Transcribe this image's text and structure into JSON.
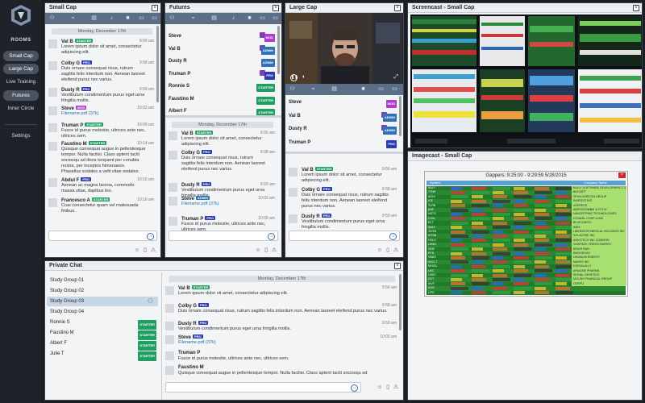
{
  "nav": {
    "rooms_label": "ROOMS",
    "items": [
      {
        "label": "Small Cap",
        "active": true
      },
      {
        "label": "Large Cap",
        "active": true
      },
      {
        "label": "Live Training",
        "active": false
      },
      {
        "label": "Futures",
        "active": true
      },
      {
        "label": "Inner Circle",
        "active": false
      }
    ],
    "settings_label": "Settings"
  },
  "small_cap": {
    "title": "Small Cap",
    "day": "Monday, December 17th",
    "messages": [
      {
        "name": "Val B",
        "badge": "STARTER",
        "badge_type": "starter",
        "time": "9:56 am",
        "text": "Lorem ipsum dolor sit amet, consectetur adipiscing elit."
      },
      {
        "name": "Colby G",
        "badge": "PRO",
        "badge_type": "pro",
        "time": "9:58 am",
        "text": "Duis ornare consequat risus, rutrum sagittis felis interdum non. Aenean laoreet eleifend purus nec varius."
      },
      {
        "name": "Dusty R",
        "badge": "PRO",
        "badge_type": "pro",
        "time": "9:59 am",
        "text": "Vestibulum condimentum purus eget urna fringilla mollis."
      },
      {
        "name": "Steve",
        "badge": "MOD",
        "badge_type": "mod",
        "time": "10:03 am",
        "text": "",
        "file": "Filename.pdf (37k)"
      },
      {
        "name": "Truman P",
        "badge": "STARTER",
        "badge_type": "starter",
        "time": "10:09 am",
        "text": "Fusce id purus molestie, ultrices ante nec, ultrices sem."
      },
      {
        "name": "Faustino M",
        "badge": "STARTER",
        "badge_type": "starter",
        "time": "10:14 am",
        "text": "Quisque consequat augue in pellentesque tempor. Nulla facilisi. Class aptent taciti sociosqu ad litora torquent per conubia nostra, per inceptos himenaeos. Phasellus sodales a velit vitae sodales."
      },
      {
        "name": "Abdul F",
        "badge": "PRO",
        "badge_type": "pro",
        "time": "10:15 am",
        "text": "Aenean ac magna lacinia, commodo massa vitae, dapibus leo."
      },
      {
        "name": "Francesco A",
        "badge": "STARTER",
        "badge_type": "starter",
        "time": "10:16 am",
        "text": "Cras consectetur quam vel malesuada finibus."
      }
    ]
  },
  "futures": {
    "title": "Futures",
    "users": [
      {
        "name": "Steve",
        "badge": "MOD",
        "badge_type": "mod",
        "icon": true
      },
      {
        "name": "Val B",
        "badge": "ADMIN",
        "badge_type": "admin",
        "icon": true
      },
      {
        "name": "Dusty R",
        "badge": "ADMIN",
        "badge_type": "admin",
        "icon": false
      },
      {
        "name": "Truman P",
        "badge": "PRO",
        "badge_type": "pro",
        "icon": true
      },
      {
        "name": "Ronnie S",
        "badge": "STARTER",
        "badge_type": "starter",
        "icon": false
      },
      {
        "name": "Faustino M",
        "badge": "STARTER",
        "badge_type": "starter",
        "icon": false
      },
      {
        "name": "Albert F",
        "badge": "STARTER",
        "badge_type": "starter",
        "icon": false
      }
    ],
    "day": "Monday, December 17th",
    "messages": [
      {
        "name": "Val B",
        "badge": "STARTER",
        "badge_type": "starter",
        "time": "9:56 am",
        "text": "Lorem ipsum dolor sit amet, consectetur adipiscing elit."
      },
      {
        "name": "Colby G",
        "badge": "PRO",
        "badge_type": "pro",
        "time": "9:58 am",
        "text": "Duis ornare consequat risus, rutrum sagittis felis interdum non. Aenean laoreet eleifend purus nec varius."
      },
      {
        "name": "Dusty R",
        "badge": "PRO",
        "badge_type": "pro",
        "time": "9:59 am",
        "text": "Vestibulum condimentum purus eget urna fringilla mollis."
      },
      {
        "name": "Steve",
        "badge": "ADMIN",
        "badge_type": "admin",
        "time": "10:03 am",
        "text": "",
        "file": "Filename.pdf (37k)"
      },
      {
        "name": "Truman P",
        "badge": "PRO",
        "badge_type": "pro",
        "time": "10:09 am",
        "text": "Fusce id purus molestie, ultrices ante nec, ultrices sem."
      }
    ]
  },
  "large_cap": {
    "title": "Large Cap",
    "users": [
      {
        "name": "Steve",
        "badge": "MOD",
        "badge_type": "mod",
        "icon": false
      },
      {
        "name": "Val B",
        "badge": "ADMIN",
        "badge_type": "admin",
        "icon": true
      },
      {
        "name": "Dusty R",
        "badge": "ADMIN",
        "badge_type": "admin",
        "icon": true
      },
      {
        "name": "Truman P",
        "badge": "PRO",
        "badge_type": "pro",
        "icon": false
      }
    ],
    "messages": [
      {
        "name": "Val B",
        "badge": "STARTER",
        "badge_type": "starter",
        "time": "9:56 am",
        "text": "Lorem ipsum dolor sit amet, consectetur adipiscing elit."
      },
      {
        "name": "Colby G",
        "badge": "PRO",
        "badge_type": "pro",
        "time": "9:58 am",
        "text": "Duis ornare consequat risus, rutrum sagittis felis interdum non. Aenean laoreet eleifend purus nec varius."
      },
      {
        "name": "Dusty R",
        "badge": "PRO",
        "badge_type": "pro",
        "time": "9:59 am",
        "text": "Vestibulum condimentum purus eget urna fringilla mollis."
      }
    ]
  },
  "screencast": {
    "title": "Screencast - Small Cap"
  },
  "imagecast": {
    "title": "Imagecast - Small Cap",
    "window_title": "Gappers:  9:25:00 - 9:29:59     5/28/2015",
    "columns": [
      "Symbol",
      "Company Name"
    ],
    "symbols": [
      "BALY",
      "TTNP",
      "ADHI",
      "ICE",
      "TLRB",
      "ANF",
      "NSTG",
      "CVIA",
      "ELT",
      "IMAX",
      "JCOM",
      "WTAB",
      "HOLX",
      "LEMU",
      "SBSI",
      "PFN",
      "VBAS",
      "ASCLT",
      "MHGA",
      "UEC",
      "LNDC",
      "DCT",
      "IKVF",
      "KGD",
      "CPS"
    ],
    "companies": [
      "BALLY SOFTWARE DEVELOPMENT CORP",
      "BIOCEPT",
      "SFHA HORIZON GROUP",
      "INVESCO BIO",
      "ASPRESS",
      "ABERCROMBIE & FITCH",
      "NANOSTRING TECHNOLOGIES",
      "DYNASIL CORP of AM",
      "BLUE EARTH",
      "IMAX",
      "LIBERATOR MEDICAL HOLDINGS INC",
      "SOLAZYME INC",
      "ADEXTECH INC COMMON",
      "VIASPACE GREEN ENERGY",
      "BRIGHTBAY",
      "BMGHEGAS",
      "URANIUM ENERGY",
      "MARKS INC",
      "DIGITALALLY",
      "ARIADNE PHARMA",
      "SIGNAL GENETICS",
      "MOLINO FINANCIAL GROUP",
      "DORPO"
    ]
  },
  "private_chat": {
    "title": "Private Chat",
    "groups": [
      {
        "label": "Study Group 01",
        "badge": "",
        "active": false
      },
      {
        "label": "Study Group 02",
        "badge": "",
        "active": false
      },
      {
        "label": "Study Group 03",
        "badge": "",
        "active": true
      },
      {
        "label": "Study Group 04",
        "badge": "",
        "active": false
      },
      {
        "label": "Ronnie S",
        "badge": "STARTER",
        "active": false
      },
      {
        "label": "Faustino M",
        "badge": "STARTER",
        "active": false
      },
      {
        "label": "Albert F",
        "badge": "STARTER",
        "active": false
      },
      {
        "label": "Julie T",
        "badge": "STARTER",
        "active": false
      }
    ],
    "day": "Monday, December 17th",
    "messages": [
      {
        "name": "Val B",
        "badge": "STARTER",
        "badge_type": "starter",
        "time": "9:56 am",
        "text": "Lorem ipsum dolor sit amet, consectetur adipiscing elit."
      },
      {
        "name": "Colby G",
        "badge": "PRO",
        "badge_type": "pro",
        "time": "9:58 am",
        "text": "Duis ornare consequat risus, rutrum sagittis felis interdum non. Aenean laoreet eleifend purus nec varius."
      },
      {
        "name": "Dusty R",
        "badge": "PRO",
        "badge_type": "pro",
        "time": "9:59 am",
        "text": "Vestibulum condimentum purus eget urna fringilla mollis."
      },
      {
        "name": "Steve",
        "badge": "PRO",
        "badge_type": "pro",
        "time": "10:03 am",
        "text": "",
        "file": "Filename.pdf (37k)"
      },
      {
        "name": "Truman P",
        "badge": "",
        "badge_type": "",
        "time": "",
        "text": "Fusce id purus molestie, ultrices ante nec, ultrices sem."
      },
      {
        "name": "Faustino M",
        "badge": "",
        "badge_type": "",
        "time": "",
        "text": "Quisque consequat augue in pellentesque tempor. Nulla facilisi. Class aptent taciti sociosqu ad"
      }
    ]
  },
  "colors": {
    "toolbar": "#5b6e86",
    "starter": "#20a060",
    "pro": "#2b3bb0",
    "mod": "#b03bd0",
    "admin": "#3072b8",
    "nav_bg": "#1f2329"
  }
}
